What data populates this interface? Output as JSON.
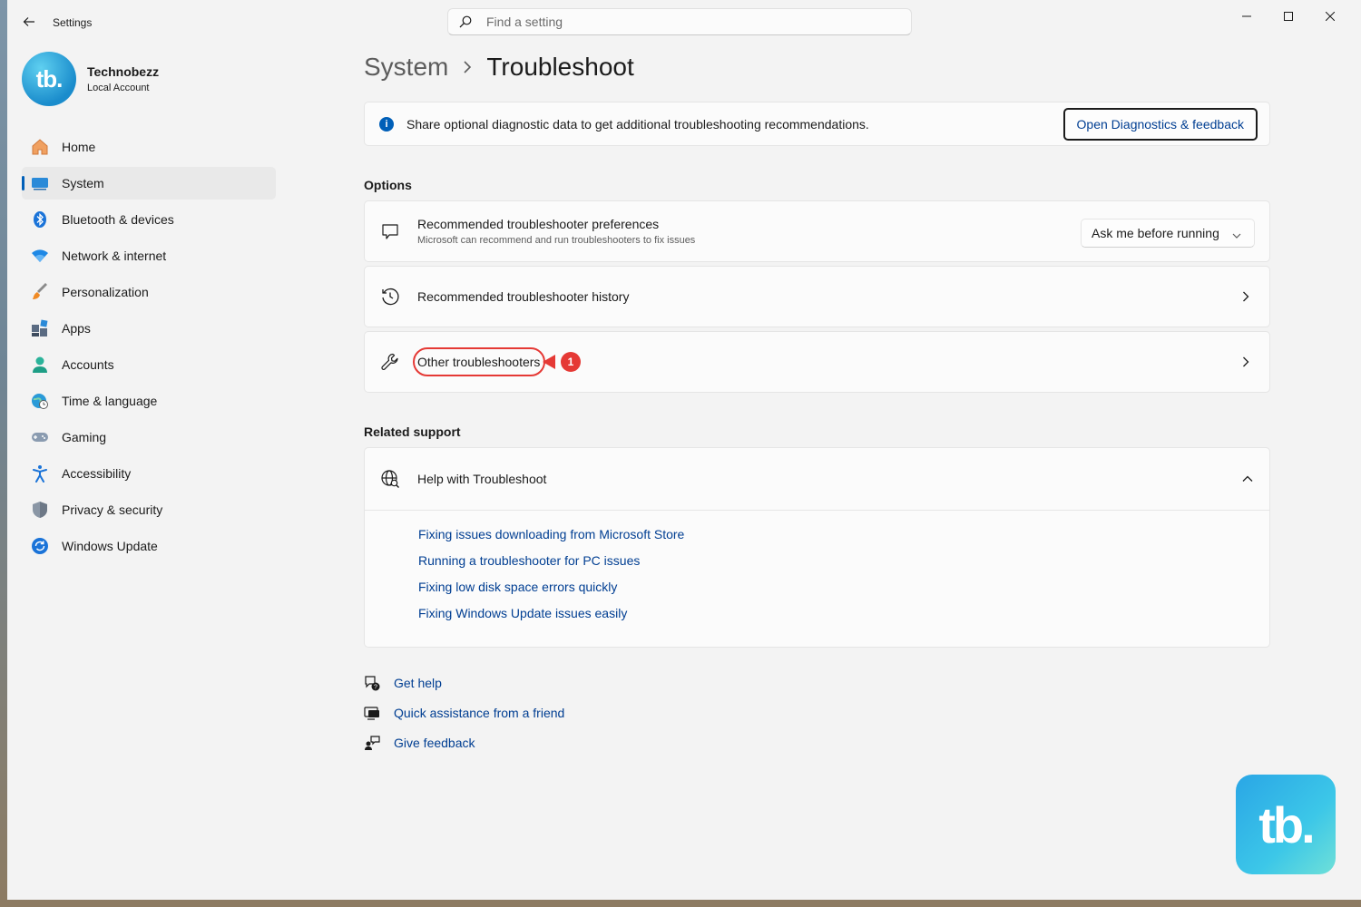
{
  "window": {
    "title": "Settings",
    "search_placeholder": "Find a setting"
  },
  "profile": {
    "initials": "tb.",
    "name": "Technobezz",
    "account_type": "Local Account"
  },
  "sidebar": {
    "items": [
      {
        "label": "Home",
        "icon": "home-icon"
      },
      {
        "label": "System",
        "icon": "system-icon",
        "active": true
      },
      {
        "label": "Bluetooth & devices",
        "icon": "bluetooth-icon"
      },
      {
        "label": "Network & internet",
        "icon": "wifi-icon"
      },
      {
        "label": "Personalization",
        "icon": "brush-icon"
      },
      {
        "label": "Apps",
        "icon": "apps-icon"
      },
      {
        "label": "Accounts",
        "icon": "accounts-icon"
      },
      {
        "label": "Time & language",
        "icon": "globe-clock-icon"
      },
      {
        "label": "Gaming",
        "icon": "gamepad-icon"
      },
      {
        "label": "Accessibility",
        "icon": "accessibility-icon"
      },
      {
        "label": "Privacy & security",
        "icon": "shield-icon"
      },
      {
        "label": "Windows Update",
        "icon": "update-icon"
      }
    ]
  },
  "breadcrumb": {
    "parent": "System",
    "current": "Troubleshoot"
  },
  "info_banner": {
    "text": "Share optional diagnostic data to get additional troubleshooting recommendations.",
    "button": "Open Diagnostics & feedback"
  },
  "options": {
    "title": "Options",
    "preferences": {
      "title": "Recommended troubleshooter preferences",
      "subtitle": "Microsoft can recommend and run troubleshooters to fix issues",
      "selected": "Ask me before running"
    },
    "history": {
      "title": "Recommended troubleshooter history"
    },
    "other": {
      "title": "Other troubleshooters",
      "badge": "1"
    }
  },
  "related": {
    "title": "Related support",
    "help_title": "Help with Troubleshoot",
    "links": [
      "Fixing issues downloading from Microsoft Store",
      "Running a troubleshooter for PC issues",
      "Fixing low disk space errors quickly",
      "Fixing Windows Update issues easily"
    ]
  },
  "footer": {
    "get_help": "Get help",
    "quick_assist": "Quick assistance from a friend",
    "feedback": "Give feedback"
  },
  "watermark": {
    "text": "tb."
  },
  "colors": {
    "accent": "#005fb8",
    "link": "#003e92",
    "annotation": "#e53935"
  }
}
